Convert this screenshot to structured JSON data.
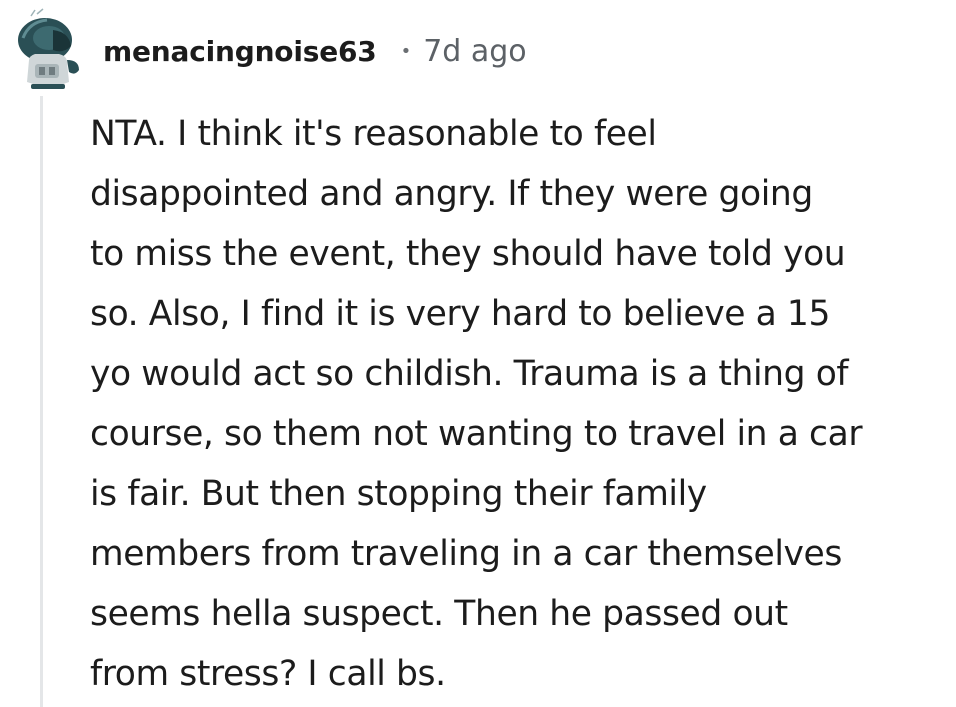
{
  "comment": {
    "username": "menacingnoise63",
    "separator": "•",
    "timestamp": "7d ago",
    "avatar_icon": "snoo-avatar-icon",
    "body_lines": [
      "NTA. I think it's reasonable to feel",
      "disappointed and angry. If they were going",
      "to miss the event, they should have told you",
      "so. Also, I find it is very hard to believe a 15",
      "yo would act so childish. Trauma is a thing of",
      "course, so them not wanting to travel in a car",
      "is fair. But then stopping their family",
      "members from traveling in a car themselves",
      "seems hella suspect. Then he passed out",
      "from stress? I call bs."
    ]
  },
  "colors": {
    "text": "#1c1c1c",
    "meta": "#5c6166",
    "thread_line": "#e4e6e8",
    "avatar_primary": "#2a4f55",
    "avatar_secondary": "#cfd6d8"
  }
}
